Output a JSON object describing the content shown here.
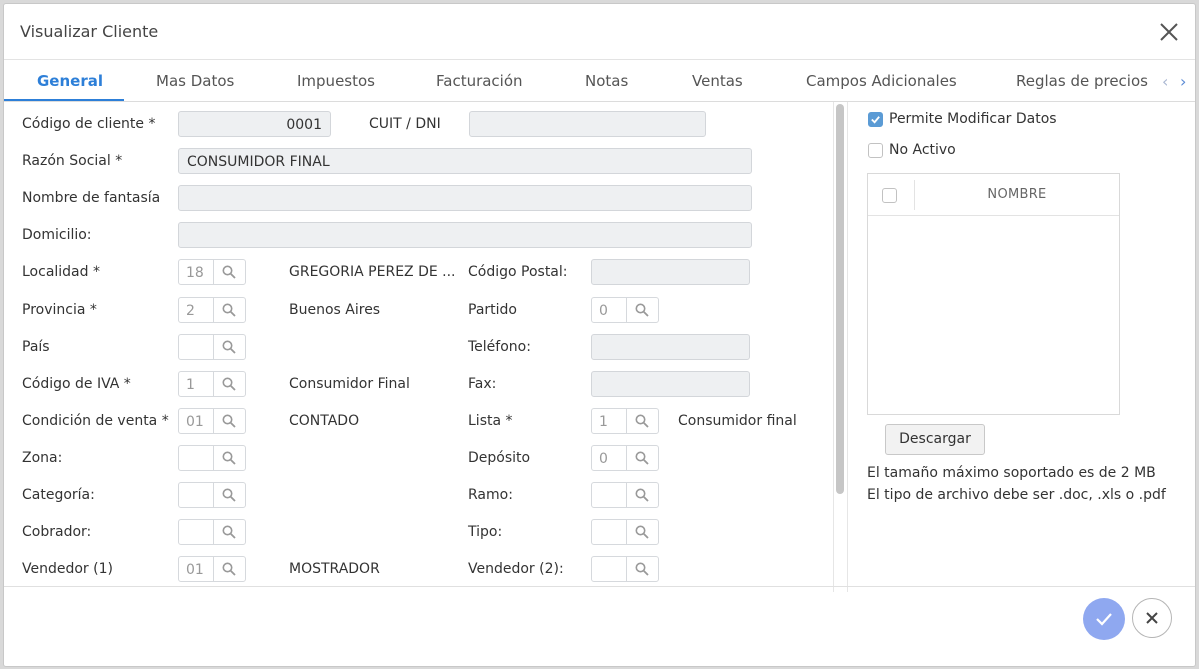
{
  "dialog": {
    "title": "Visualizar Cliente",
    "close_icon": "close-icon"
  },
  "tabs": [
    {
      "label": "General",
      "active": true
    },
    {
      "label": "Mas Datos"
    },
    {
      "label": "Impuestos"
    },
    {
      "label": "Facturación"
    },
    {
      "label": "Notas"
    },
    {
      "label": "Ventas"
    },
    {
      "label": "Campos Adicionales"
    },
    {
      "label": "Reglas de precios"
    }
  ],
  "form": {
    "codigo_cliente": {
      "label": "Código de cliente *",
      "value": "0001"
    },
    "cuit": {
      "label": "CUIT / DNI",
      "value": ""
    },
    "razon_social": {
      "label": "Razón Social *",
      "value": "CONSUMIDOR FINAL"
    },
    "nombre_fantasia": {
      "label": "Nombre de fantasía",
      "value": ""
    },
    "domicilio": {
      "label": "Domicilio:",
      "value": ""
    },
    "localidad": {
      "label": "Localidad *",
      "code": "18",
      "desc": "GREGORIA PEREZ DE ..."
    },
    "codigo_postal": {
      "label": "Código Postal:",
      "value": ""
    },
    "provincia": {
      "label": "Provincia *",
      "code": "2",
      "desc": "Buenos Aires"
    },
    "partido": {
      "label": "Partido",
      "code": "0"
    },
    "pais": {
      "label": "País",
      "code": ""
    },
    "telefono": {
      "label": "Teléfono:",
      "value": ""
    },
    "codigo_iva": {
      "label": "Código de IVA *",
      "code": "1",
      "desc": "Consumidor Final"
    },
    "fax": {
      "label": "Fax:",
      "value": ""
    },
    "condicion_venta": {
      "label": "Condición de venta *",
      "code": "01",
      "desc": "CONTADO"
    },
    "lista": {
      "label": "Lista *",
      "code": "1",
      "desc": "Consumidor final"
    },
    "zona": {
      "label": "Zona:",
      "code": ""
    },
    "deposito": {
      "label": "Depósito",
      "code": "0"
    },
    "categoria": {
      "label": "Categoría:",
      "code": ""
    },
    "ramo": {
      "label": "Ramo:",
      "code": ""
    },
    "cobrador": {
      "label": "Cobrador:",
      "code": ""
    },
    "tipo": {
      "label": "Tipo:",
      "code": ""
    },
    "vendedor1": {
      "label": "Vendedor (1)",
      "code": "01",
      "desc": "MOSTRADOR"
    },
    "vendedor2": {
      "label": "Vendedor (2):",
      "code": ""
    }
  },
  "side": {
    "permite_modificar": {
      "label": "Permite Modificar Datos",
      "checked": true
    },
    "no_activo": {
      "label": "No Activo",
      "checked": false
    },
    "attachments": {
      "column_header": "NOMBRE",
      "rows": []
    },
    "download_label": "Descargar",
    "info_size": "El tamaño máximo soportado es de 2 MB",
    "info_type": "El tipo de archivo debe ser .doc, .xls o .pdf"
  },
  "footer": {
    "confirm_icon": "check-icon",
    "cancel_icon": "close-icon"
  },
  "colors": {
    "accent": "#2d7fd8",
    "confirm_button": "#8fa8f0",
    "checkbox_on": "#5b9bd5"
  }
}
